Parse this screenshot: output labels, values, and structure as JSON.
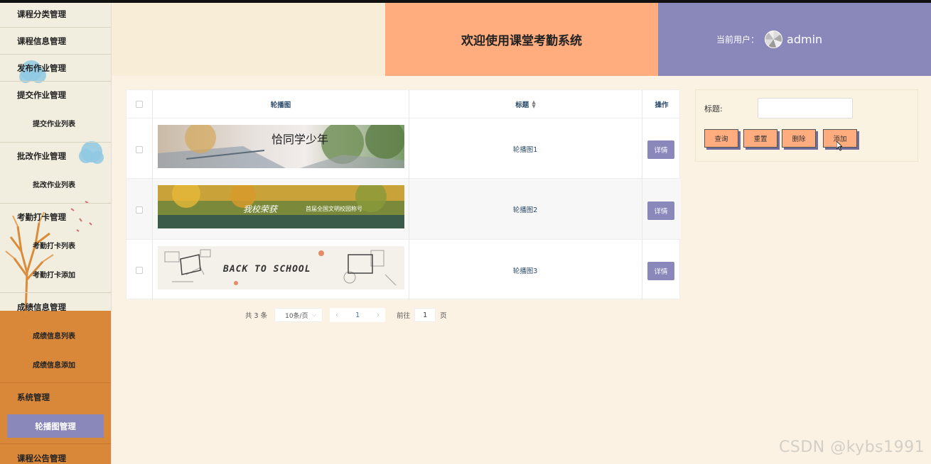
{
  "sidebar": {
    "items": [
      {
        "label": "课程分类管理"
      },
      {
        "label": "课程信息管理"
      },
      {
        "label": "发布作业管理"
      },
      {
        "label": "提交作业管理"
      },
      {
        "label": "提交作业列表"
      },
      {
        "label": "批改作业管理"
      },
      {
        "label": "批改作业列表"
      },
      {
        "label": "考勤打卡管理"
      },
      {
        "label": "考勤打卡列表"
      },
      {
        "label": "考勤打卡添加"
      },
      {
        "label": "成绩信息管理"
      },
      {
        "label": "成绩信息列表"
      },
      {
        "label": "成绩信息添加"
      },
      {
        "label": "系统管理"
      },
      {
        "label": "轮播图管理"
      },
      {
        "label": "课程公告管理"
      }
    ]
  },
  "header": {
    "title": "欢迎使用课堂考勤系统",
    "user_label": "当前用户：",
    "username": "admin"
  },
  "table": {
    "columns": [
      "轮播图",
      "标题",
      "操作"
    ],
    "rows": [
      {
        "title": "轮播图1",
        "action": "详情",
        "banner_text": "恰同学少年"
      },
      {
        "title": "轮播图2",
        "action": "详情",
        "banner_text": "我校荣获",
        "banner_sub": "首届全国文明校园称号"
      },
      {
        "title": "轮播图3",
        "action": "详情",
        "banner_text": "BACK TO SCHOOL"
      }
    ]
  },
  "pagination": {
    "total": "共 3 条",
    "page_size": "10条/页",
    "current": "1",
    "goto_label": "前往",
    "goto_value": "1",
    "page_suffix": "页"
  },
  "search": {
    "title_label": "标题:",
    "title_value": "",
    "buttons": {
      "query": "查询",
      "reset": "重置",
      "delete": "删除",
      "add": "添加"
    }
  },
  "watermark": "CSDN @kybs1991",
  "colors": {
    "orange": "#ffad7f",
    "purple": "#8a88bb",
    "cream": "#fbf2e3",
    "sidebar_orange": "#d9883a"
  }
}
